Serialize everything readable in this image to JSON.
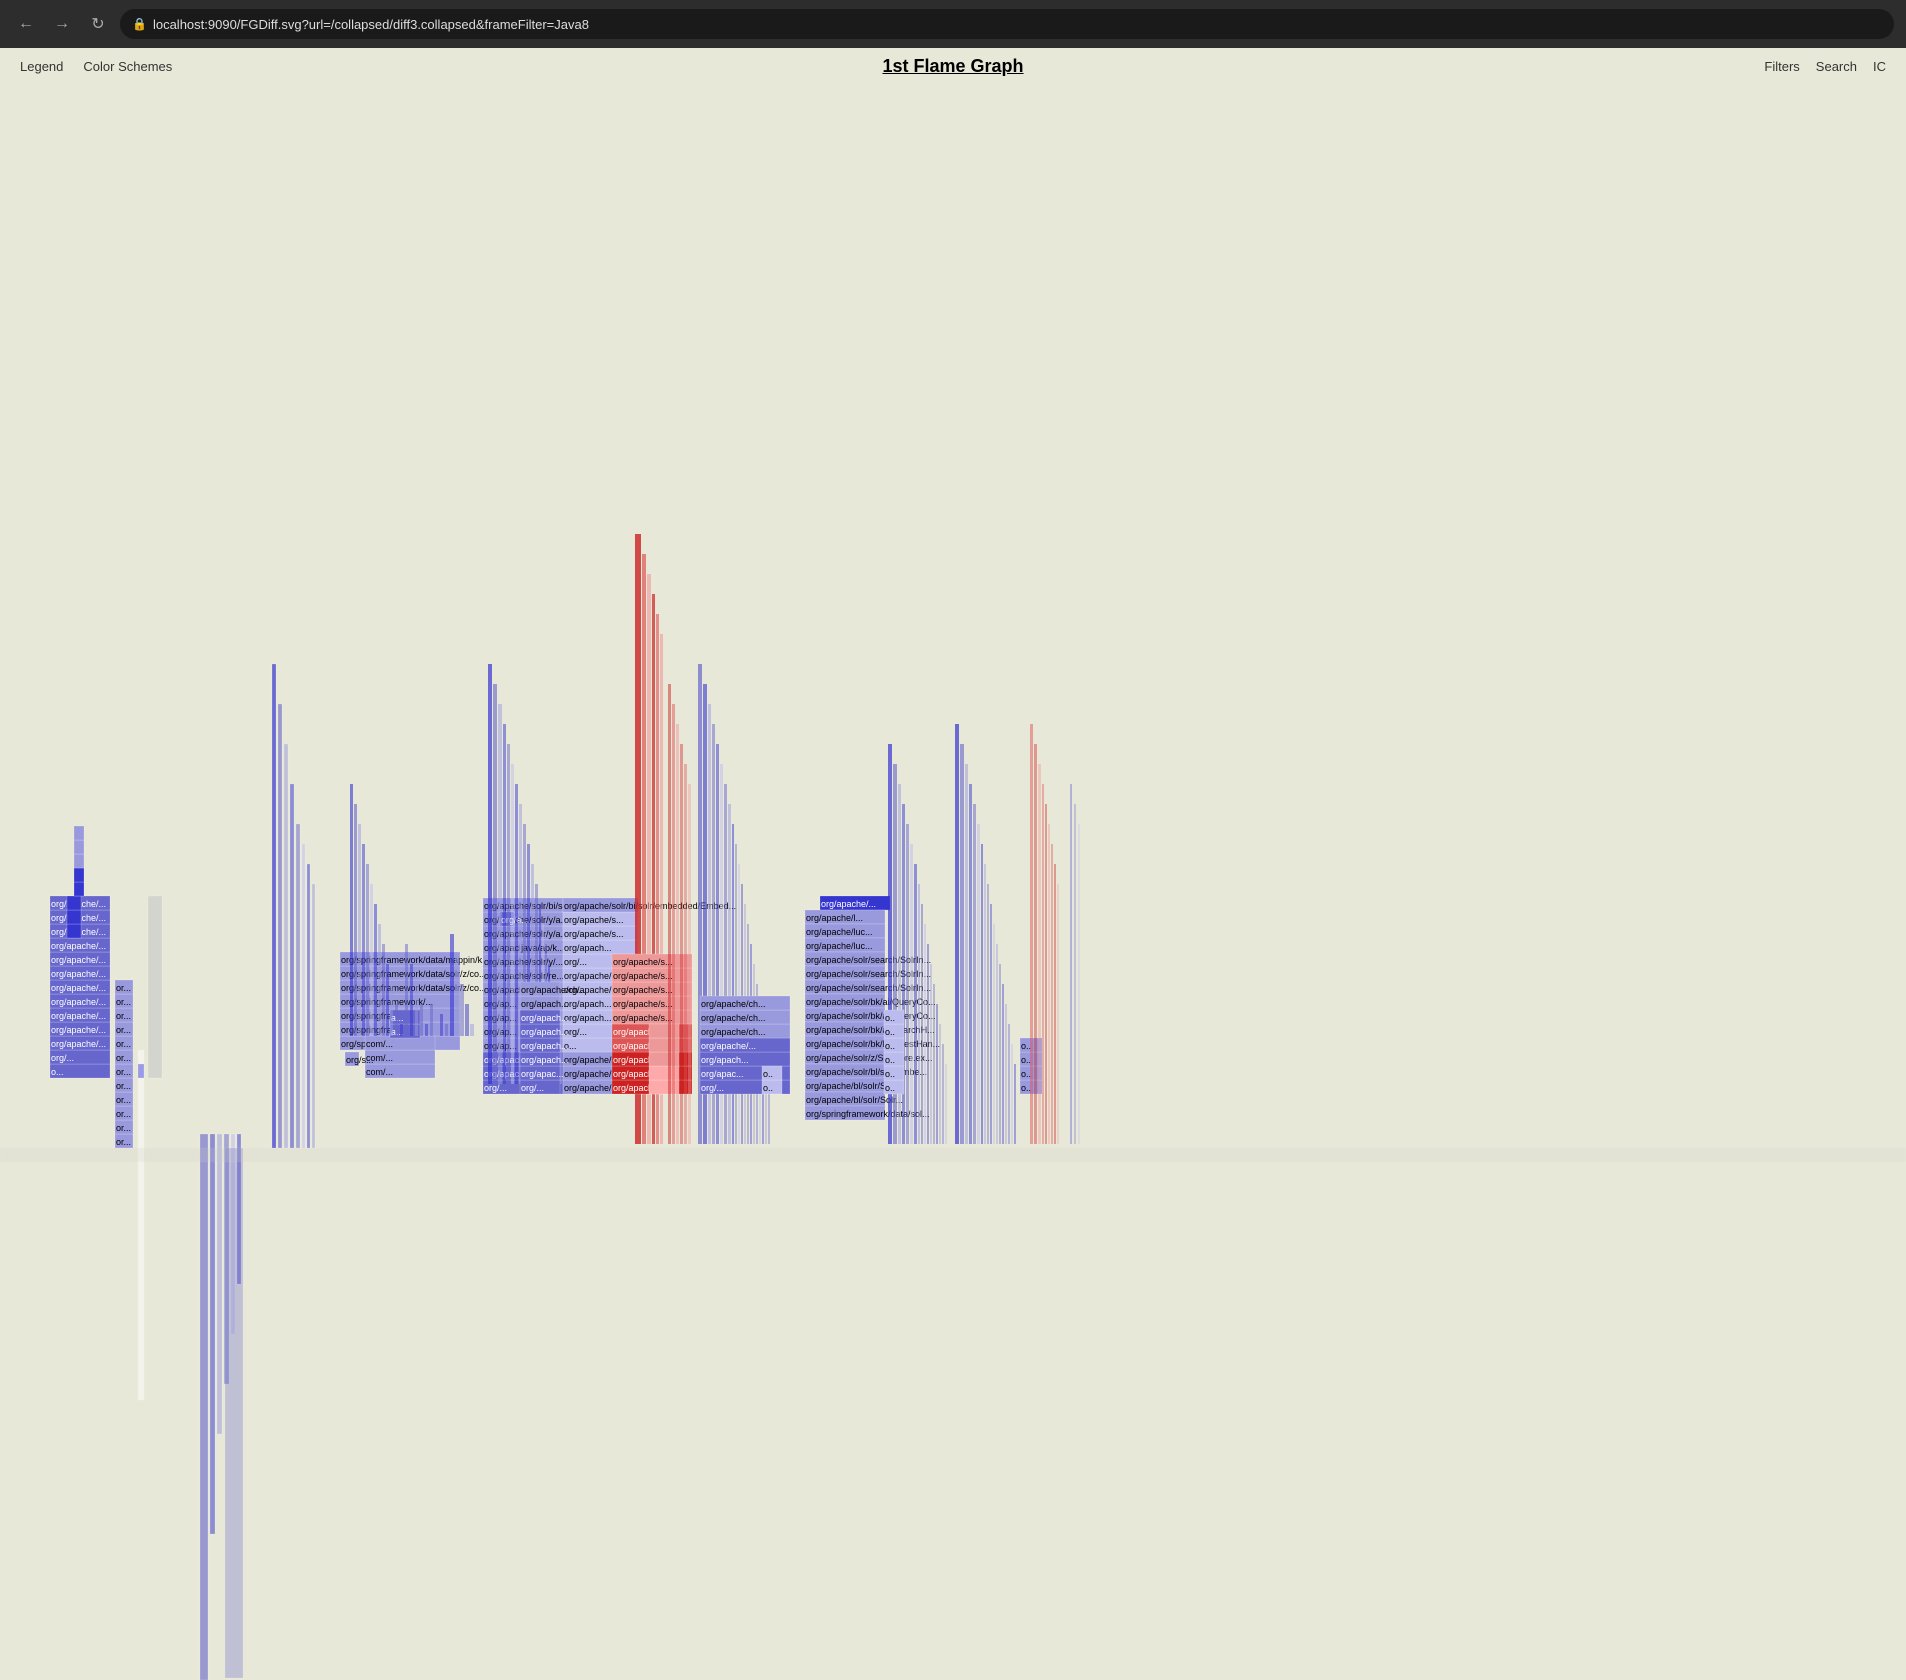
{
  "browser": {
    "back_icon": "←",
    "forward_icon": "→",
    "reload_icon": "↺",
    "lock_icon": "🔒",
    "url": "localhost:9090/FGDiff.svg?url=/collapsed/diff3.collapsed&frameFilter=Java8"
  },
  "toolbar": {
    "legend_label": "Legend",
    "color_schemes_label": "Color Schemes",
    "title": "1st Flame Graph",
    "filters_label": "Filters",
    "search_label": "Search",
    "ic_label": "IC"
  },
  "flamegraph": {
    "description": "Differential flame graph showing Java8 frame filter with blue (decreased) and red (increased) stacks"
  }
}
